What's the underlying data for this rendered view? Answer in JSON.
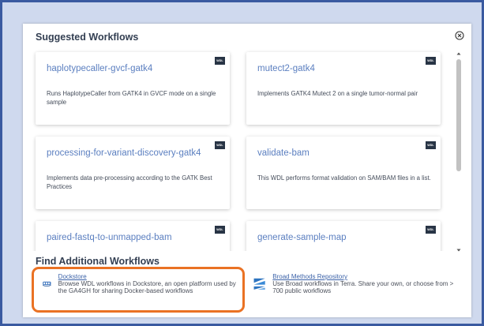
{
  "modal": {
    "title": "Suggested Workflows",
    "close_icon": "close-circle-icon"
  },
  "workflows": [
    {
      "name": "haplotypecaller-gvcf-gatk4",
      "description": "Runs HaplotypeCaller from GATK4 in GVCF mode on a single sample",
      "badge": "WDL"
    },
    {
      "name": "mutect2-gatk4",
      "description": "Implements GATK4 Mutect 2 on a single tumor-normal pair",
      "badge": "WDL"
    },
    {
      "name": "processing-for-variant-discovery-gatk4",
      "description": "Implements data pre-processing according to the GATK Best Practices",
      "badge": "WDL"
    },
    {
      "name": "validate-bam",
      "description": "This WDL performs format validation on SAM/BAM files in a list.",
      "badge": "WDL"
    },
    {
      "name": "paired-fastq-to-unmapped-bam",
      "description": "",
      "badge": "WDL"
    },
    {
      "name": "generate-sample-map",
      "description": "",
      "badge": "WDL"
    }
  ],
  "additional": {
    "title": "Find Additional Workflows",
    "sources": [
      {
        "name": "Dockstore",
        "description": "Browse WDL workflows in Dockstore, an open platform used by the GA4GH for sharing Docker-based workflows",
        "icon": "dockstore-icon"
      },
      {
        "name": "Broad Methods Repository",
        "description": "Use Broad workflows in Terra. Share your own, or choose from > 700 public workflows",
        "icon": "broad-methods-icon"
      }
    ]
  },
  "colors": {
    "background": "#cfd9ee",
    "frame": "#3a5aa0",
    "link": "#5b7fc0",
    "highlight": "#ea7224",
    "badge": "#283445"
  }
}
